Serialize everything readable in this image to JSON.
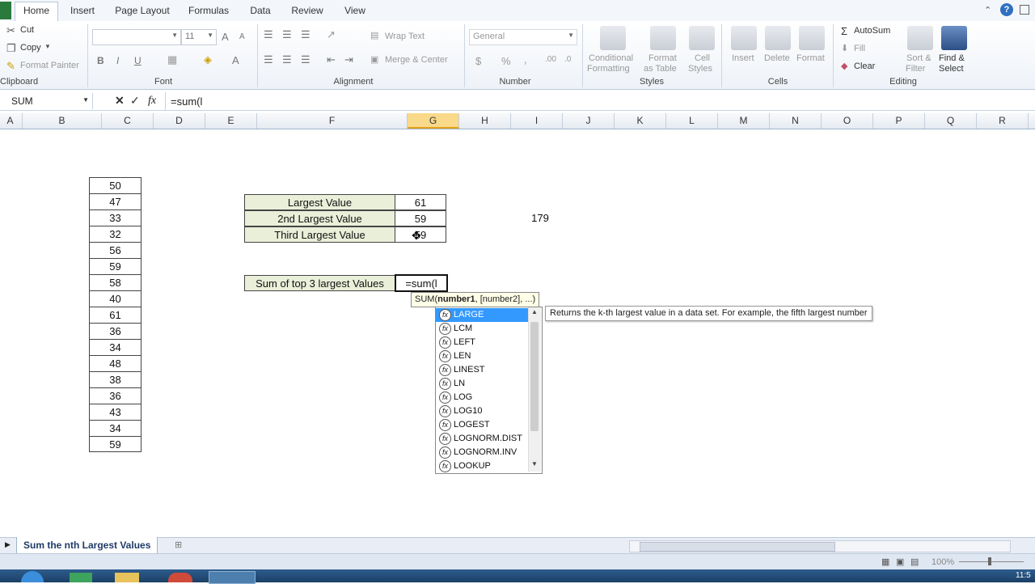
{
  "tabs": [
    "Home",
    "Insert",
    "Page Layout",
    "Formulas",
    "Data",
    "Review",
    "View"
  ],
  "active_tab": "Home",
  "clipboard": {
    "cut": "Cut",
    "copy": "Copy",
    "format_painter": "Format Painter",
    "label": "Clipboard"
  },
  "font": {
    "name": "",
    "size": "11",
    "label": "Font",
    "bold": "B",
    "italic": "I",
    "underline": "U",
    "grow": "A",
    "shrink": "A",
    "color_a": "A"
  },
  "alignment": {
    "wrap_text": "Wrap Text",
    "merge_center": "Merge & Center",
    "label": "Alignment"
  },
  "number": {
    "format": "General",
    "currency": "$",
    "percent": "%",
    "comma": ",",
    "label": "Number"
  },
  "styles": {
    "conditional": "Conditional",
    "formatting": "Formatting",
    "format": "Format",
    "as_table": "as Table",
    "cell": "Cell",
    "cell_styles": "Styles",
    "label": "Styles"
  },
  "cells": {
    "insert": "Insert",
    "delete": "Delete",
    "format": "Format",
    "label": "Cells"
  },
  "editing": {
    "autosum": "AutoSum",
    "fill": "Fill",
    "clear": "Clear",
    "sort": "Sort &",
    "filter": "Filter",
    "find": "Find &",
    "select": "Select",
    "label": "Editing"
  },
  "formula_bar": {
    "name_box": "SUM",
    "fx": "fx",
    "formula": "=sum(l"
  },
  "columns": [
    "A",
    "B",
    "C",
    "D",
    "E",
    "F",
    "G",
    "H",
    "I",
    "J",
    "K",
    "L",
    "M",
    "N",
    "O",
    "P",
    "Q",
    "R"
  ],
  "selected_column": "G",
  "column_c_values": [
    "50",
    "47",
    "33",
    "32",
    "56",
    "59",
    "58",
    "40",
    "61",
    "36",
    "34",
    "48",
    "38",
    "36",
    "43",
    "34",
    "59"
  ],
  "table": {
    "rows": [
      {
        "label": "Largest Value",
        "value": "61"
      },
      {
        "label": "2nd Largest Value",
        "value": "59"
      },
      {
        "label": "Third Largest Value",
        "value": "59"
      }
    ]
  },
  "side_value": "179",
  "sum_row": {
    "label": "Sum of top 3 largest Values",
    "editing": "=sum(l"
  },
  "tooltip_signature": {
    "fn": "SUM(",
    "arg1": "number1",
    "rest": ", [number2], ...)"
  },
  "autocomplete": {
    "items": [
      "LARGE",
      "LCM",
      "LEFT",
      "LEN",
      "LINEST",
      "LN",
      "LOG",
      "LOG10",
      "LOGEST",
      "LOGNORM.DIST",
      "LOGNORM.INV",
      "LOOKUP"
    ],
    "selected": "LARGE",
    "description": "Returns the k-th largest value in a data set. For example, the fifth largest number"
  },
  "sheet_tab": "Sum the nth Largest Values",
  "zoom": "100%",
  "clock": "11:5"
}
